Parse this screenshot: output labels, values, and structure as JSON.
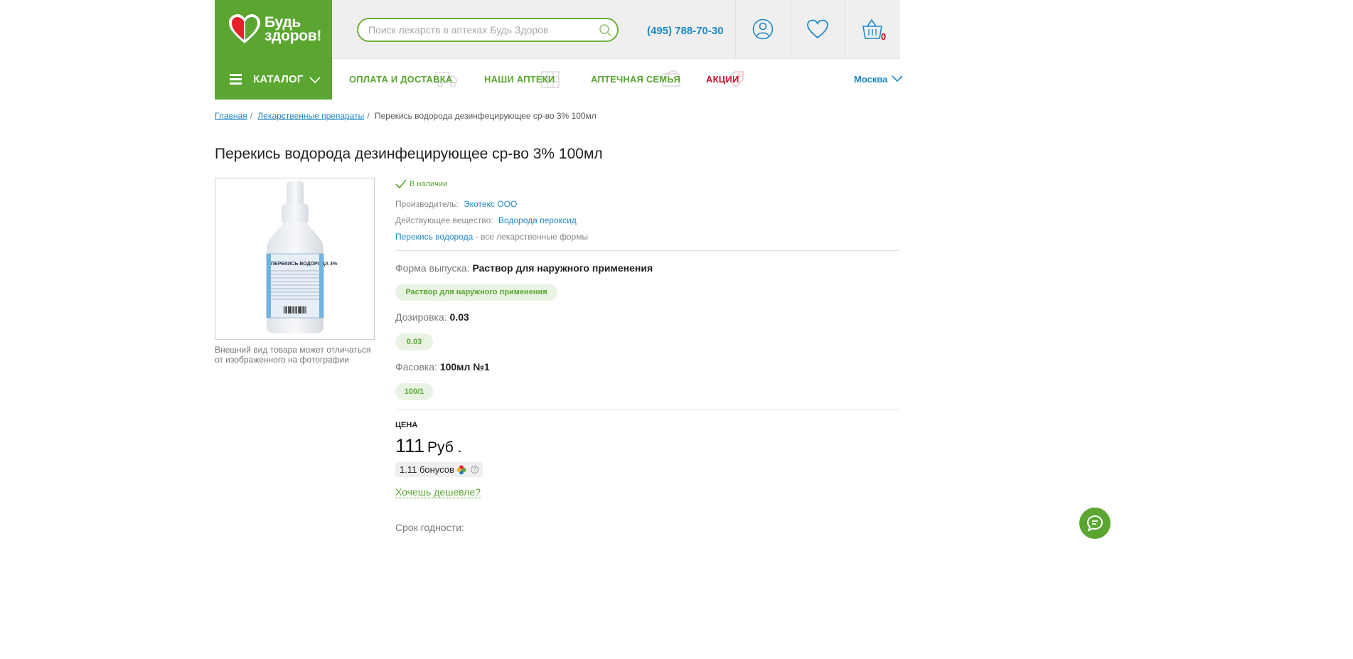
{
  "header": {
    "logo_line1": "Будь",
    "logo_line2": "здоров!",
    "search_placeholder": "Поиск лекарств в аптеках Будь Здоров",
    "phone": "(495) 788-70-30",
    "cart_count": "0",
    "icons": [
      "user-icon",
      "heart-icon",
      "basket-icon",
      "search-icon"
    ]
  },
  "nav": {
    "catalog_label": "КАТАЛОГ",
    "items": [
      {
        "label": "ОПЛАТА И ДОСТАВКА"
      },
      {
        "label": "НАШИ АПТЕКИ"
      },
      {
        "label": "АПТЕЧНАЯ СЕМЬЯ"
      },
      {
        "label": "АКЦИИ"
      }
    ],
    "city": "Москва"
  },
  "breadcrumb": {
    "home": "Главная",
    "category": "Лекарственные препараты",
    "current": "Перекись водорода дезинфецирующее ср-во 3% 100мл"
  },
  "product": {
    "title": "Перекись водорода дезинфецирующее ср-во 3% 100мл",
    "bottle_label": "ПЕРЕКИСЬ ВОДОРОДА 3%",
    "image_note": "Внешний вид товара может отличаться от изображенного на фотографии",
    "availability": "В наличии",
    "manufacturer_label": "Производитель:",
    "manufacturer": "Экотекс ООО",
    "substance_label": "Действующее вещество:",
    "substance": "Водорода пероксид",
    "forms_link": "Перекись водорода",
    "forms_suffix": "- все лекарственные формы",
    "form_label": "Форма выпуска:",
    "form_value": "Раствор для наружного применения",
    "form_chip": "Раствор для наружного применения",
    "dosage_label": "Дозировка:",
    "dosage_value": "0.03",
    "dosage_chip": "0.03",
    "pack_label": "Фасовка:",
    "pack_value": "100мл №1",
    "pack_chip": "100/1",
    "price_label": "ЦЕНА",
    "price": "111",
    "currency": "Руб .",
    "bonus": "1.11 бонусов",
    "cheaper_link": "Хочешь дешевле?",
    "shelf_life_label": "Срок годности:"
  },
  "colors": {
    "brand_green": "#5aa631",
    "link_blue": "#1e88c7",
    "promo_red": "#c8102e"
  }
}
